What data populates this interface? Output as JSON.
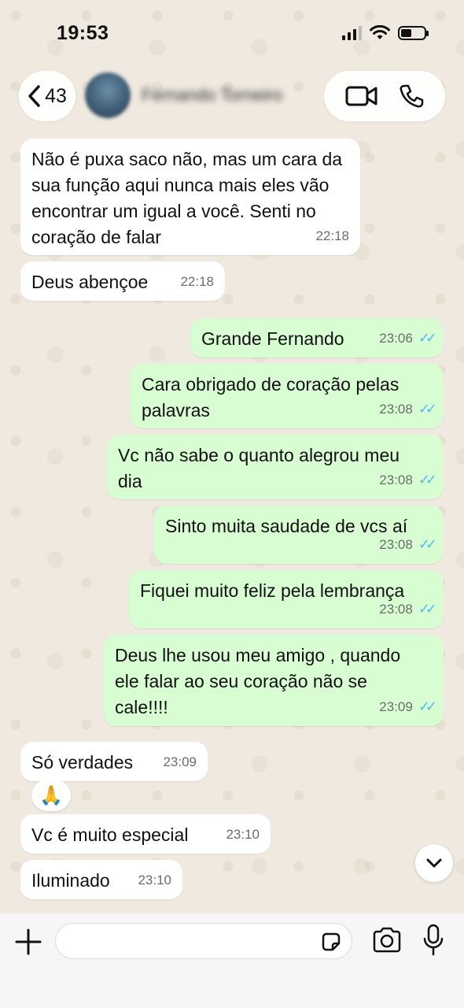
{
  "status_bar": {
    "time": "19:53"
  },
  "header": {
    "back_count": "43",
    "contact_name": "Fernando Torneiro"
  },
  "messages": [
    {
      "dir": "in",
      "text": "Não é puxa saco não, mas um cara da sua função aqui nunca mais eles vão encontrar um igual a você. Senti no coração de falar",
      "time": "22:18"
    },
    {
      "dir": "in",
      "text": "Deus abençoe",
      "time": "22:18"
    },
    {
      "dir": "out",
      "text": "Grande Fernando",
      "time": "23:06",
      "status": "read"
    },
    {
      "dir": "out",
      "text": "Cara obrigado de coração pelas palavras",
      "time": "23:08",
      "status": "read"
    },
    {
      "dir": "out",
      "text": "Vc não sabe o quanto alegrou meu dia",
      "time": "23:08",
      "status": "read"
    },
    {
      "dir": "out",
      "text": "Sinto muita saudade de vcs aí",
      "time": "23:08",
      "status": "read"
    },
    {
      "dir": "out",
      "text": "Fiquei muito feliz pela lembrança",
      "time": "23:08",
      "status": "read"
    },
    {
      "dir": "out",
      "text": "Deus lhe usou meu amigo , quando ele falar ao seu coração não se cale!!!!",
      "time": "23:09",
      "status": "read"
    },
    {
      "dir": "in",
      "text": "Só verdades",
      "time": "23:09",
      "reaction": "🙏"
    },
    {
      "dir": "in",
      "text": "Vc é muito especial",
      "time": "23:10"
    },
    {
      "dir": "in",
      "text": "Iluminado",
      "time": "23:10"
    }
  ],
  "input": {
    "placeholder": ""
  },
  "colors": {
    "outgoing": "#d9fdd3",
    "incoming": "#ffffff",
    "read_ticks": "#53bdeb"
  },
  "icons": [
    "back-chevron-icon",
    "video-call-icon",
    "phone-icon",
    "plus-icon",
    "sticker-icon",
    "camera-icon",
    "mic-icon",
    "chevron-down-icon",
    "double-check-icon"
  ]
}
